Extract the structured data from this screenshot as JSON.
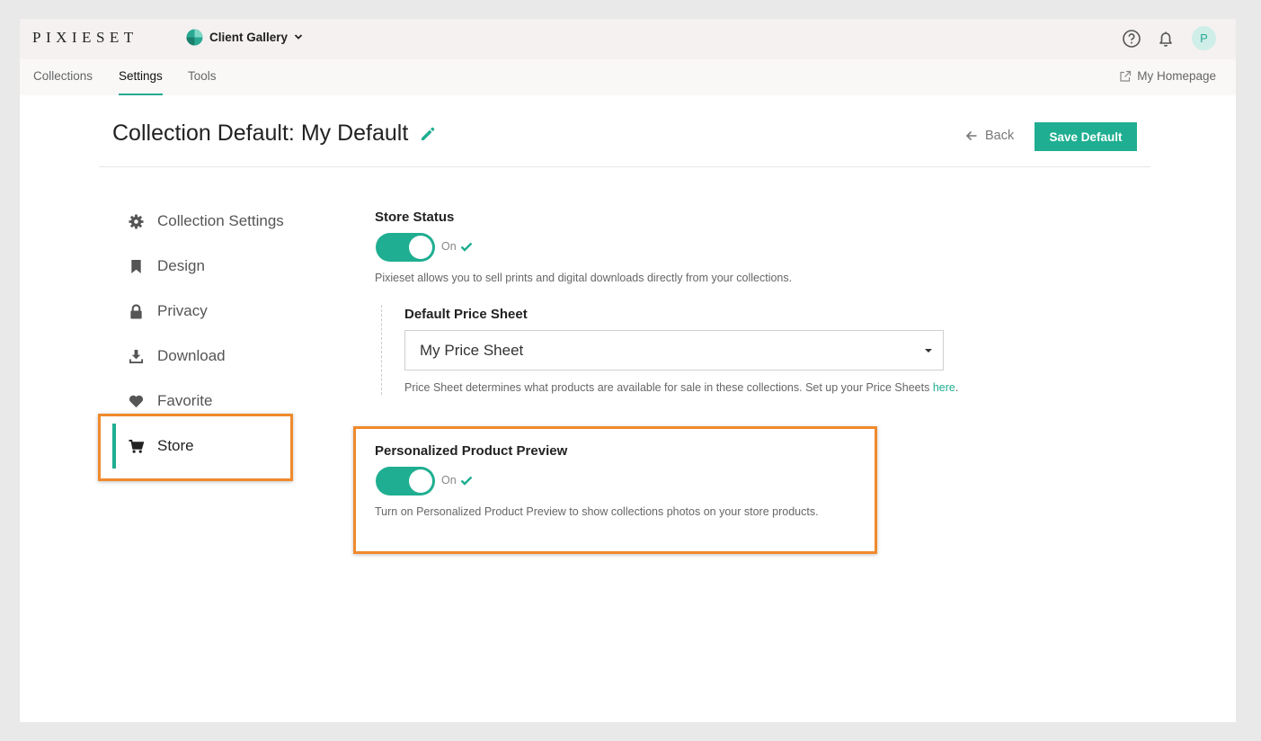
{
  "topbar": {
    "logo": "PIXIESET",
    "product": "Client Gallery"
  },
  "nav": {
    "tabs": [
      {
        "label": "Collections",
        "active": false
      },
      {
        "label": "Settings",
        "active": true
      },
      {
        "label": "Tools",
        "active": false
      }
    ],
    "homepage": "My Homepage"
  },
  "user": {
    "avatar_letter": "P"
  },
  "header": {
    "title": "Collection Default: My Default",
    "back_label": "Back",
    "save_label": "Save Default"
  },
  "sidebar": {
    "items": [
      {
        "label": "Collection Settings",
        "icon": "gear-icon"
      },
      {
        "label": "Design",
        "icon": "bookmark-icon"
      },
      {
        "label": "Privacy",
        "icon": "lock-icon"
      },
      {
        "label": "Download",
        "icon": "download-icon"
      },
      {
        "label": "Favorite",
        "icon": "heart-icon"
      },
      {
        "label": "Store",
        "icon": "cart-icon",
        "active": true
      }
    ]
  },
  "store_status": {
    "title": "Store Status",
    "state": "On",
    "description": "Pixieset allows you to sell prints and digital downloads directly from your collections."
  },
  "price_sheet": {
    "title": "Default Price Sheet",
    "selected": "My Price Sheet",
    "description": "Price Sheet determines what products are available for sale in these collections. Set up your Price Sheets",
    "link": "here",
    "period": "."
  },
  "preview": {
    "title": "Personalized Product Preview",
    "state": "On",
    "description": "Turn on Personalized Product Preview to show collections photos on your store products."
  },
  "colors": {
    "accent": "#1fae91",
    "highlight": "#f08a2c"
  }
}
